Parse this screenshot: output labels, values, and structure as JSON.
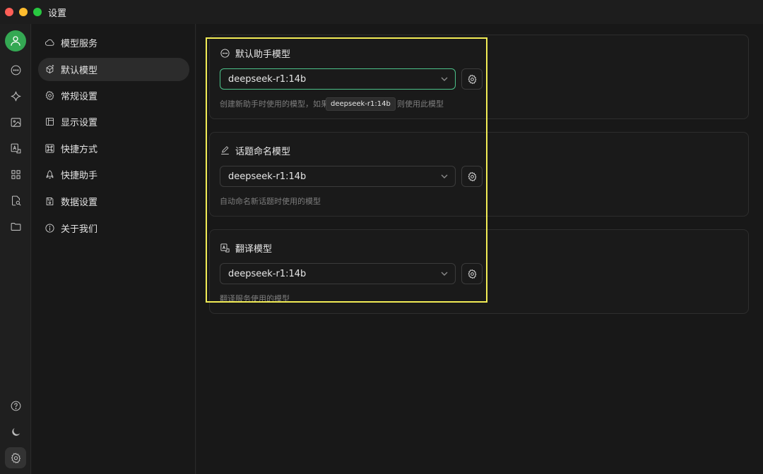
{
  "window": {
    "title": "设置"
  },
  "rail": {
    "icons": [
      "avatar-icon",
      "chat-icon",
      "sparkle-icon",
      "image-icon",
      "translate-icon",
      "apps-icon",
      "file-search-icon",
      "folder-icon",
      "help-icon",
      "moon-icon",
      "gear-icon"
    ]
  },
  "menu": {
    "items": [
      {
        "label": "模型服务",
        "icon": "cloud-icon"
      },
      {
        "label": "默认模型",
        "icon": "cube-sparkle-icon",
        "active": true
      },
      {
        "label": "常规设置",
        "icon": "gear-icon"
      },
      {
        "label": "显示设置",
        "icon": "layout-icon"
      },
      {
        "label": "快捷方式",
        "icon": "command-icon"
      },
      {
        "label": "快捷助手",
        "icon": "rocket-icon"
      },
      {
        "label": "数据设置",
        "icon": "save-icon"
      },
      {
        "label": "关于我们",
        "icon": "info-icon"
      }
    ]
  },
  "cards": [
    {
      "title": "默认助手模型",
      "icon": "chat-bubble-icon",
      "selected_model": "deepseek-r1:14b",
      "hint": "创建新助手时使用的模型，如果",
      "hint_tail": "则使用此模型",
      "focused": true
    },
    {
      "title": "话题命名模型",
      "icon": "pencil-icon",
      "selected_model": "deepseek-r1:14b",
      "hint": "自动命名新话题时使用的模型"
    },
    {
      "title": "翻译模型",
      "icon": "translate-icon",
      "selected_model": "deepseek-r1:14b",
      "hint": "翻译服务使用的模型"
    }
  ],
  "tooltip": {
    "text": "deepseek-r1:14b"
  },
  "colors": {
    "accent": "#4cc38a",
    "highlight": "#f2ec55",
    "avatar": "#34a853"
  }
}
